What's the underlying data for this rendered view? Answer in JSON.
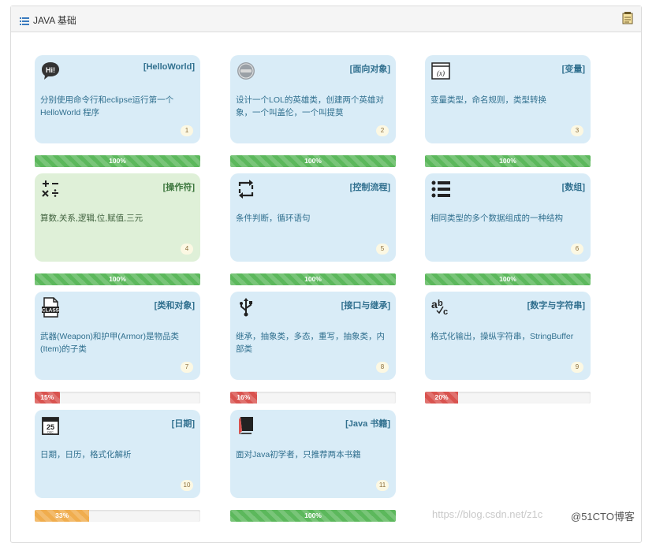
{
  "panel": {
    "title": "JAVA 基础"
  },
  "cards": [
    {
      "title": "[HelloWorld]",
      "desc": "分别使用命令行和eclipse运行第一个HelloWorld 程序",
      "num": "1",
      "progress": 100,
      "progress_label": "100%",
      "icon": "hi-speech-bubble-icon"
    },
    {
      "title": "[面向对象]",
      "desc": "设计一个LOL的英雄类，创建两个英雄对象，一个叫盖伦，一个叫提莫",
      "num": "2",
      "progress": 100,
      "progress_label": "100%",
      "icon": "lol-logo-icon"
    },
    {
      "title": "[变量]",
      "desc": "变量类型，命名规则，类型转换",
      "num": "3",
      "progress": 100,
      "progress_label": "100%",
      "icon": "variable-window-icon"
    },
    {
      "title": "[操作符]",
      "desc": "算数,关系,逻辑,位,赋值,三元",
      "num": "4",
      "progress": 100,
      "progress_label": "100%",
      "icon": "math-operators-icon"
    },
    {
      "title": "[控制流程]",
      "desc": "条件判断，循环语句",
      "num": "5",
      "progress": 100,
      "progress_label": "100%",
      "icon": "loop-arrows-icon"
    },
    {
      "title": "[数组]",
      "desc": "相同类型的多个数据组成的一种结构",
      "num": "6",
      "progress": 100,
      "progress_label": "100%",
      "icon": "list-bullets-icon"
    },
    {
      "title": "[类和对象]",
      "desc": "武器(Weapon)和护甲(Armor)是物品类(Item)的子类",
      "num": "7",
      "progress": 15,
      "progress_label": "15%",
      "icon": "class-file-icon"
    },
    {
      "title": "[接口与继承]",
      "desc": "继承，抽象类，多态，重写，抽象类，内部类",
      "num": "8",
      "progress": 16,
      "progress_label": "16%",
      "icon": "usb-icon"
    },
    {
      "title": "[数字与字符串]",
      "desc": "格式化输出，操纵字符串，StringBuffer",
      "num": "9",
      "progress": 20,
      "progress_label": "20%",
      "icon": "spellcheck-abc-icon"
    },
    {
      "title": "[日期]",
      "desc": "日期，日历，格式化解析",
      "num": "10",
      "progress": 33,
      "progress_label": "33%",
      "icon": "calendar-icon"
    },
    {
      "title": "[Java 书籍]",
      "desc": "面对Java初学者，只推荐两本书籍",
      "num": "11",
      "progress": 100,
      "progress_label": "100%",
      "icon": "book-icon"
    }
  ],
  "colors": {
    "card_blue": "#d9ecf7",
    "card_green": "#dff0d8",
    "success": "#5cb85c",
    "danger": "#d9534f",
    "warning": "#f0ad4e"
  },
  "watermark": "https://blog.csdn.net/z1c",
  "watermark_brand": "@51CTO博客"
}
